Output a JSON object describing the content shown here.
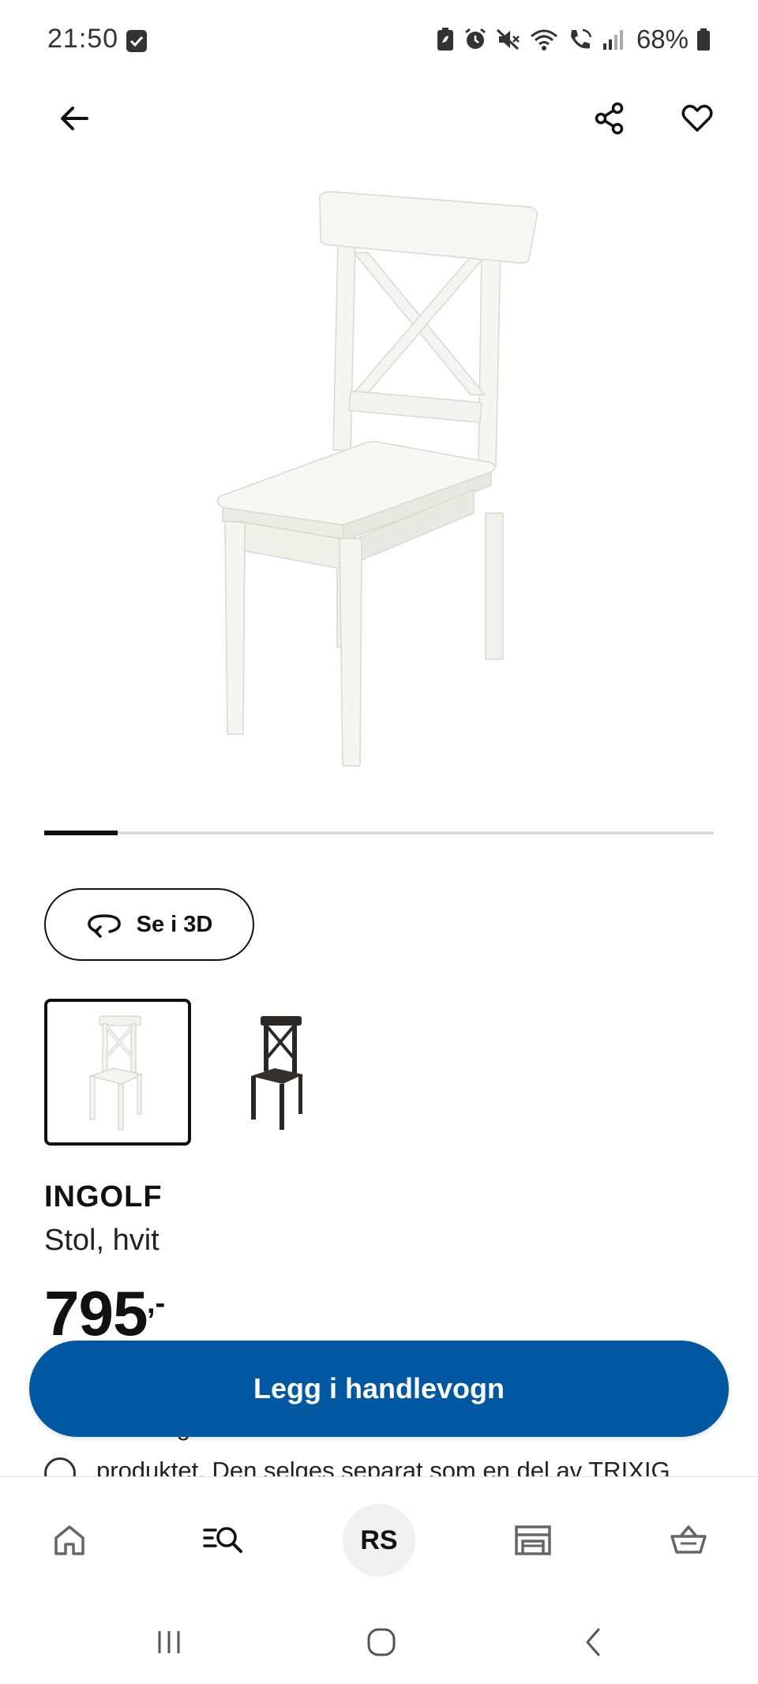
{
  "status_bar": {
    "time": "21:50",
    "battery": "68%"
  },
  "appbar": {
    "back_icon": "arrow-left-icon",
    "share_icon": "share-icon",
    "favorite_icon": "heart-icon"
  },
  "gallery": {
    "progress": 0.11
  },
  "view_3d": {
    "label": "Se i 3D",
    "icon": "rotate-360-icon"
  },
  "variants": [
    {
      "color": "white",
      "selected": true
    },
    {
      "color": "black-brown",
      "selected": false
    }
  ],
  "product": {
    "name": "INGOLF",
    "description": "Stol, hvit",
    "price": "795",
    "price_suffix": ",-"
  },
  "info": {
    "line1": "Du trenger en skrutrekker for å montere dette",
    "line2": "produktet. Den selges separat som en del av TRIXIG"
  },
  "cart_button": {
    "label": "Legg i handlevogn"
  },
  "bottom_nav": {
    "items": [
      "home-icon",
      "search-icon",
      "profile-avatar",
      "store-icon",
      "basket-icon"
    ],
    "avatar_initials": "RS"
  },
  "colors": {
    "primary_blue": "#0058a3",
    "text": "#111111"
  }
}
